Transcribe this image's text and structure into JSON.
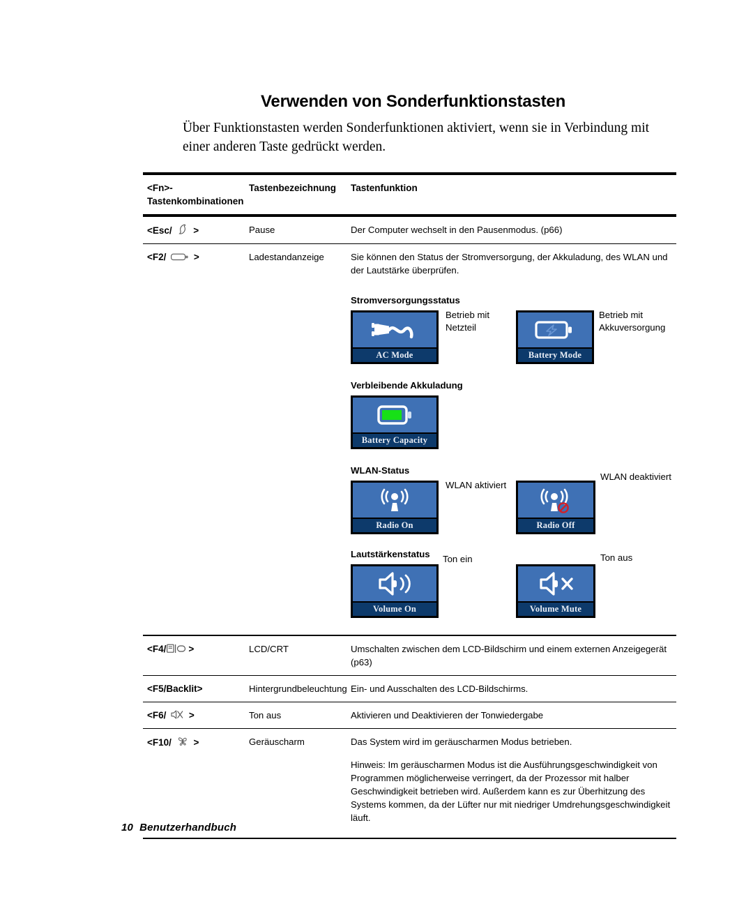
{
  "document": {
    "title": "Verwenden von Sonderfunktionstasten",
    "intro": "Über Funktionstasten werden Sonderfunktionen aktiviert, wenn sie in Verbindung mit einer anderen Taste gedrückt werden."
  },
  "table": {
    "headers": {
      "col1": "<Fn>-Tastenkombinationen",
      "col2": "Tastenbezeichnung",
      "col3": "Tastenfunktion"
    },
    "rows": [
      {
        "key_prefix": "<Esc/",
        "key_icon": "moon-icon",
        "key_suffix": ">",
        "name": "Pause",
        "function": "Der Computer wechselt in den Pausenmodus. (p66)"
      },
      {
        "key_prefix": "<F2/",
        "key_icon": "battery-icon",
        "key_suffix": ">",
        "name": "Ladestandanzeige",
        "function": "Sie können den Status der Stromversorgung, der Akkuladung, des WLAN und der Lautstärke überprüfen."
      },
      {
        "key_prefix": "<F4/",
        "key_icon": "lcd-crt-icon",
        "key_suffix": ">",
        "name": "LCD/CRT",
        "function": "Umschalten zwischen dem LCD-Bildschirm und einem externen Anzeigegerät (p63)"
      },
      {
        "key_prefix": "<F5/Backlit>",
        "key_icon": "",
        "key_suffix": "",
        "name": "Hintergrundbeleuchtung",
        "function": "Ein- und Ausschalten des LCD-Bildschirms."
      },
      {
        "key_prefix": "<F6/",
        "key_icon": "speaker-mute-icon",
        "key_suffix": ">",
        "name": "Ton aus",
        "function": "Aktivieren und Deaktivieren der Tonwiedergabe"
      },
      {
        "key_prefix": "<F10/",
        "key_icon": "fan-icon",
        "key_suffix": ">",
        "name": "Geräuscharm",
        "function": "Das System wird im geräuscharmen Modus betrieben."
      }
    ],
    "note": "Hinweis: Im geräuscharmen Modus ist die Ausführungsgeschwindigkeit von Programmen möglicherweise verringert, da der Prozessor mit halber Geschwindigkeit betrieben wird. Außerdem kann es zur Überhitzung des Systems kommen, da der Lüfter nur mit niedriger Umdrehungsgeschwindigkeit läuft."
  },
  "status_sections": [
    {
      "heading": "Stromversorgungsstatus",
      "items": [
        {
          "caption": "AC Mode",
          "icon": "ac-plug-icon",
          "description": "Betrieb mit Netzteil"
        },
        {
          "caption": "Battery Mode",
          "icon": "battery-charging-icon",
          "description": "Betrieb mit Akkuversorgung"
        }
      ]
    },
    {
      "heading": "Verbleibende Akkuladung",
      "items": [
        {
          "caption": "Battery Capacity",
          "icon": "battery-full-icon",
          "description": ""
        }
      ]
    },
    {
      "heading": "WLAN-Status",
      "items": [
        {
          "caption": "Radio On",
          "icon": "antenna-icon",
          "description": "WLAN aktiviert"
        },
        {
          "caption": "Radio Off",
          "icon": "antenna-disabled-icon",
          "description": "WLAN deaktiviert"
        }
      ]
    },
    {
      "heading": "Lautstärkenstatus",
      "items": [
        {
          "caption": "Volume On",
          "icon": "speaker-on-icon",
          "description": "Ton ein"
        },
        {
          "caption": "Volume Mute",
          "icon": "speaker-mute-icon",
          "description": "Ton aus"
        }
      ]
    }
  ],
  "footer": {
    "page_number": "10",
    "label": "Benutzerhandbuch"
  },
  "colors": {
    "icon_panel_blue": "#3f71b5",
    "icon_caption_navy": "#0d3a6b",
    "battery_green": "#17e017",
    "disabled_red": "#d41f26"
  }
}
